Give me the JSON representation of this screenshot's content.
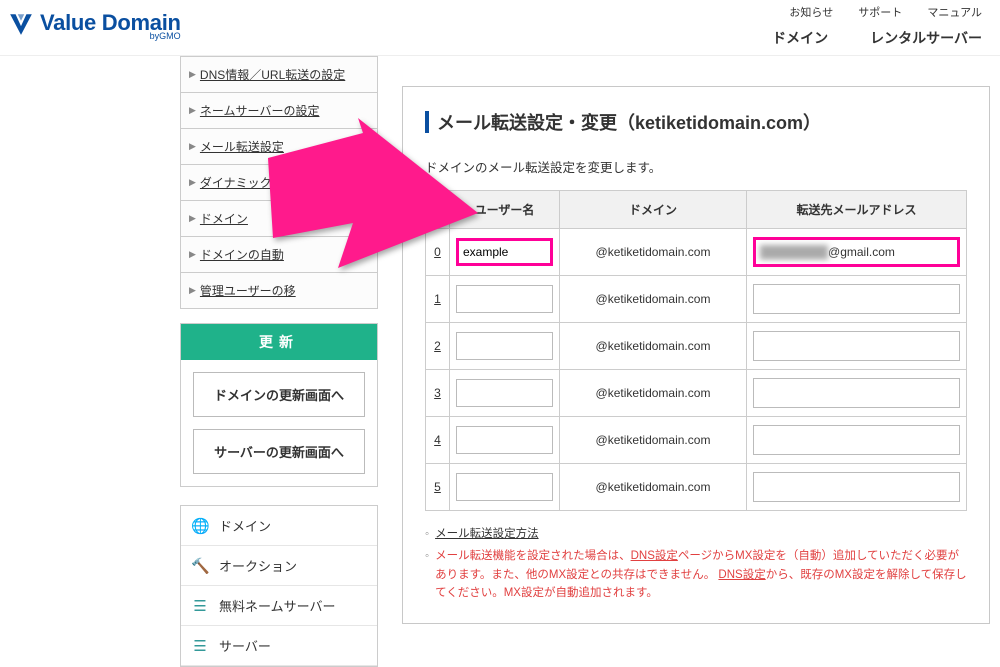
{
  "header": {
    "brand_main": "Value Domain",
    "brand_sub": "byGMO",
    "top_links": [
      "お知らせ",
      "サポート",
      "マニュアル"
    ],
    "tabs": [
      "ドメイン",
      "レンタルサーバー"
    ]
  },
  "sidebar": {
    "nav": [
      "DNS情報／URL転送の設定",
      "ネームサーバーの設定",
      "メール転送設定",
      "ダイナミックDNSの設定",
      "ドメイン",
      "ドメインの自動",
      "管理ユーザーの移"
    ],
    "update": {
      "heading": "更新",
      "btn1": "ドメインの更新画面へ",
      "btn2": "サーバーの更新画面へ"
    },
    "menu2": [
      {
        "icon": "🌐",
        "label": "ドメイン"
      },
      {
        "icon": "🔨",
        "label": "オークション"
      },
      {
        "icon": "☰",
        "label": "無料ネームサーバー"
      },
      {
        "icon": "☰",
        "label": "サーバー"
      }
    ]
  },
  "content": {
    "title": "メール転送設定・変更（ketiketidomain.com）",
    "description": "ドメインのメール転送設定を変更します。",
    "columns": {
      "user": "ユーザー名",
      "domain": "ドメイン",
      "forward": "転送先メールアドレス"
    },
    "rows": [
      {
        "idx": "0",
        "user": "example",
        "domain": "@ketiketidomain.com",
        "fw_obscured": "████████",
        "fw_suffix": "@gmail.com",
        "hl": true
      },
      {
        "idx": "1",
        "user": "",
        "domain": "@ketiketidomain.com",
        "fw_obscured": "",
        "fw_suffix": "",
        "hl": false
      },
      {
        "idx": "2",
        "user": "",
        "domain": "@ketiketidomain.com",
        "fw_obscured": "",
        "fw_suffix": "",
        "hl": false
      },
      {
        "idx": "3",
        "user": "",
        "domain": "@ketiketidomain.com",
        "fw_obscured": "",
        "fw_suffix": "",
        "hl": false
      },
      {
        "idx": "4",
        "user": "",
        "domain": "@ketiketidomain.com",
        "fw_obscured": "",
        "fw_suffix": "",
        "hl": false
      },
      {
        "idx": "5",
        "user": "",
        "domain": "@ketiketidomain.com",
        "fw_obscured": "",
        "fw_suffix": "",
        "hl": false
      }
    ],
    "notes": {
      "n1": "メール転送設定方法",
      "n2a": "メール転送機能を設定された場合は、",
      "n2b": "DNS設定",
      "n2c": "ページからMX設定を（自動）追加していただく必要があります。また、他のMX設定との共存はできません。 ",
      "n2d": "DNS設定",
      "n2e": "から、既存のMX設定を解除して保存してください。MX設定が自動追加されます。"
    }
  }
}
